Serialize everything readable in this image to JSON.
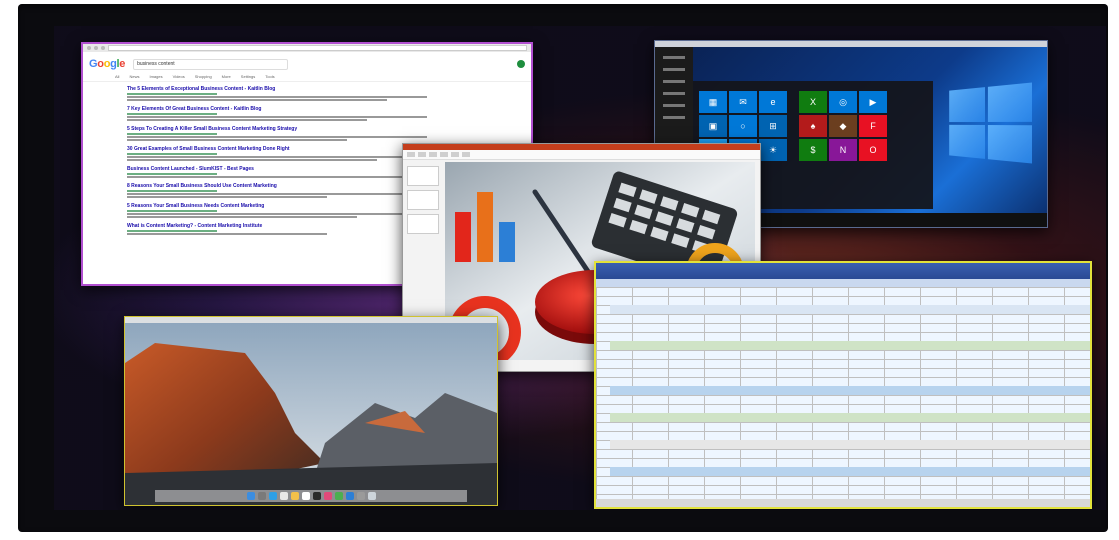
{
  "browser": {
    "logo_letters": [
      "G",
      "o",
      "o",
      "g",
      "l",
      "e"
    ],
    "query": "business content",
    "tabs": [
      "All",
      "News",
      "Images",
      "Videos",
      "Shopping",
      "More",
      "Settings",
      "Tools"
    ],
    "results": [
      "The 5 Elements of Exceptional Business Content - Kaitlin Blog",
      "7 Key Elements Of Great Business Content - Kaitlin Blog",
      "5 Steps To Creating A Killer Small Business Content Marketing Strategy",
      "30 Great Examples of Small Business Content Marketing Done Right",
      "Business Content Launched - SlumKIST - Best Pages",
      "8 Reasons Your Small Business Should Use Content Marketing",
      "5 Reasons Your Small Business Needs Content Marketing",
      "What is Content Marketing? - Content Marketing Institute"
    ]
  },
  "colors": {
    "browser_border": "#b14fd0",
    "mac_border": "#cfc230",
    "excel_border": "#e2e23a",
    "ppt_accent": "#c43e1c"
  },
  "icons": [
    "windows-logo-icon",
    "twitter-icon",
    "store-icon",
    "mail-icon",
    "edge-icon"
  ]
}
